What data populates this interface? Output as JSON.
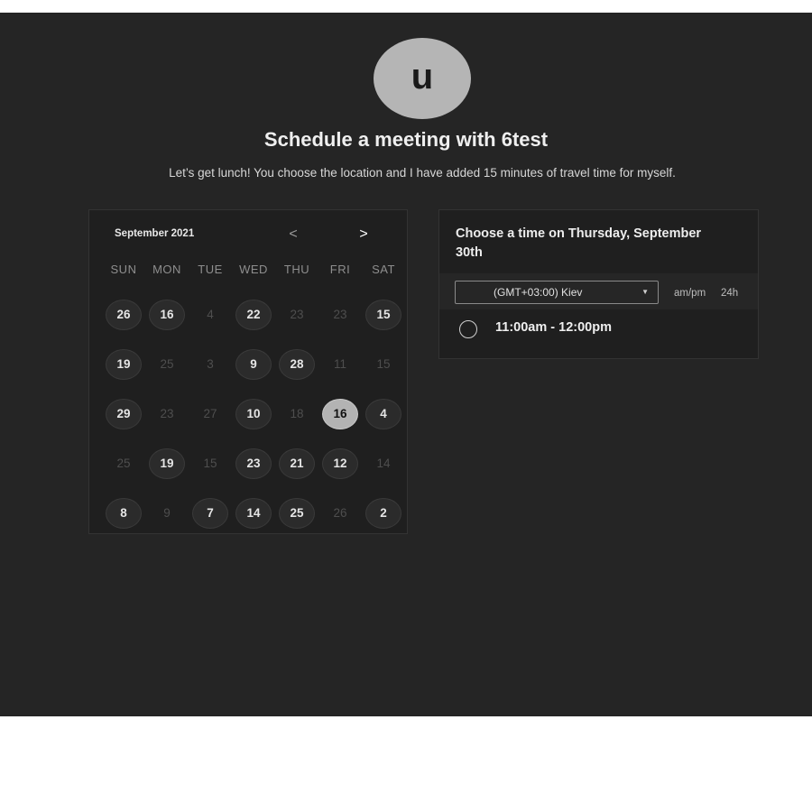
{
  "avatar": {
    "initial": "u"
  },
  "header": {
    "title": "Schedule a meeting with 6test",
    "subtitle": "Let’s get lunch! You choose the location and I have added 15 minutes of travel time for myself."
  },
  "calendar": {
    "month_label": "September 2021",
    "prev_label": "<",
    "next_label": ">",
    "weekdays": [
      "SUN",
      "MON",
      "TUE",
      "WED",
      "THU",
      "FRI",
      "SAT"
    ],
    "weeks": [
      [
        {
          "d": "26",
          "a": true
        },
        {
          "d": "16",
          "a": true
        },
        {
          "d": "4",
          "a": false
        },
        {
          "d": "22",
          "a": true
        },
        {
          "d": "23",
          "a": false
        },
        {
          "d": "23",
          "a": false
        },
        {
          "d": "15",
          "a": true
        }
      ],
      [
        {
          "d": "19",
          "a": true
        },
        {
          "d": "25",
          "a": false
        },
        {
          "d": "3",
          "a": false
        },
        {
          "d": "9",
          "a": true
        },
        {
          "d": "28",
          "a": true
        },
        {
          "d": "11",
          "a": false
        },
        {
          "d": "15",
          "a": false
        }
      ],
      [
        {
          "d": "29",
          "a": true
        },
        {
          "d": "23",
          "a": false
        },
        {
          "d": "27",
          "a": false
        },
        {
          "d": "10",
          "a": true
        },
        {
          "d": "18",
          "a": false
        },
        {
          "d": "16",
          "a": true,
          "sel": true
        },
        {
          "d": "4",
          "a": true
        }
      ],
      [
        {
          "d": "25",
          "a": false
        },
        {
          "d": "19",
          "a": true
        },
        {
          "d": "15",
          "a": false
        },
        {
          "d": "23",
          "a": true
        },
        {
          "d": "21",
          "a": true
        },
        {
          "d": "12",
          "a": true
        },
        {
          "d": "14",
          "a": false
        }
      ],
      [
        {
          "d": "8",
          "a": true
        },
        {
          "d": "9",
          "a": false
        },
        {
          "d": "7",
          "a": true
        },
        {
          "d": "14",
          "a": true
        },
        {
          "d": "25",
          "a": true
        },
        {
          "d": "26",
          "a": false
        },
        {
          "d": "2",
          "a": true
        }
      ]
    ]
  },
  "time_panel": {
    "heading": "Choose a time on Thursday, September 30th",
    "timezone": "(GMT+03:00) Kiev",
    "format_ampm": "am/pm",
    "format_24h": "24h",
    "slots": [
      "11:00am - 12:00pm"
    ]
  }
}
